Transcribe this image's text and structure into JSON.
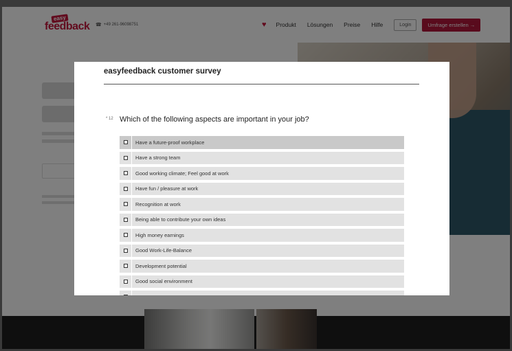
{
  "site": {
    "logo_badge": "easy",
    "logo_main": "feedback",
    "phone": "+49 261-96098751",
    "nav": [
      "Produkt",
      "Lösungen",
      "Preise",
      "Hilfe"
    ],
    "login_label": "Login",
    "cta_label": "Umfrage erstellen →"
  },
  "survey": {
    "title": "easyfeedback customer survey",
    "question_number": "* 12",
    "question": "Which of the following aspects are important in your job?",
    "options": [
      "Have a future-proof workplace",
      "Have a strong team",
      "Good working climate; Feel good at work",
      "Have fun / pleasure at work",
      "Recognition at work",
      "Being able to contribute your own ideas",
      "High money earnings",
      "Good Work-Life-Balance",
      "Development potential",
      "Good social environment",
      ""
    ],
    "hovered_index": 0
  },
  "colors": {
    "brand": "#c4163c",
    "cta": "#b3163a",
    "option_bg": "#e2e2e2",
    "option_hover": "#c9c9c9"
  }
}
